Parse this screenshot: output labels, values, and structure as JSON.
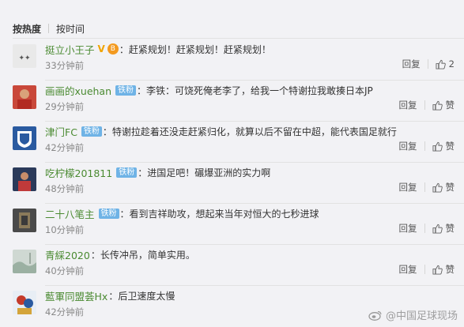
{
  "tabs": {
    "hot": "按热度",
    "time": "按时间"
  },
  "comments": [
    {
      "user": "挺立小王子",
      "badge": "",
      "vip": "V",
      "medal": "B",
      "text": "：赶紧规划！赶紧规划！赶紧规划！",
      "time": "33分钟前",
      "reply": "回复",
      "like": "2"
    },
    {
      "user": "画画的xuehan",
      "badge": "铁粉",
      "text": "：李铁：可饶死俺老李了，给我一个特谢拉我敢揍日本JP",
      "time": "29分钟前",
      "reply": "回复",
      "like": "赞"
    },
    {
      "user": "津门FC",
      "badge": "铁粉",
      "text": "：特谢拉趁着还没走赶紧归化，就算以后不留在中超，能代表国足就行",
      "time": "42分钟前",
      "reply": "回复",
      "like": "赞"
    },
    {
      "user": "吃柠檬201811",
      "badge": "铁粉",
      "text": "：进国足吧！碾爆亚洲的实力啊",
      "time": "48分钟前",
      "reply": "回复",
      "like": "赞"
    },
    {
      "user": "二十八笔主",
      "badge": "铁粉",
      "text": "：看到吉祥助攻，想起来当年对恒大的七秒进球",
      "time": "10分钟前",
      "reply": "回复",
      "like": "赞"
    },
    {
      "user": "青綵2020",
      "badge": "",
      "text": "：长传冲吊，简单实用。",
      "time": "40分钟前",
      "reply": "回复",
      "like": "赞"
    },
    {
      "user": "藍軍同盟荟Hx",
      "badge": "",
      "text": "：后卫速度太慢",
      "time": "42分钟前",
      "reply": "回复",
      "like": "赞"
    }
  ],
  "watermark": "@中国足球现场",
  "icons": {
    "like": "thumbs-up-icon",
    "weibo": "weibo-logo-icon"
  },
  "colors": {
    "username": "#4a8a31",
    "badge": "#6fb3e6",
    "background": "#f2f2f5"
  }
}
